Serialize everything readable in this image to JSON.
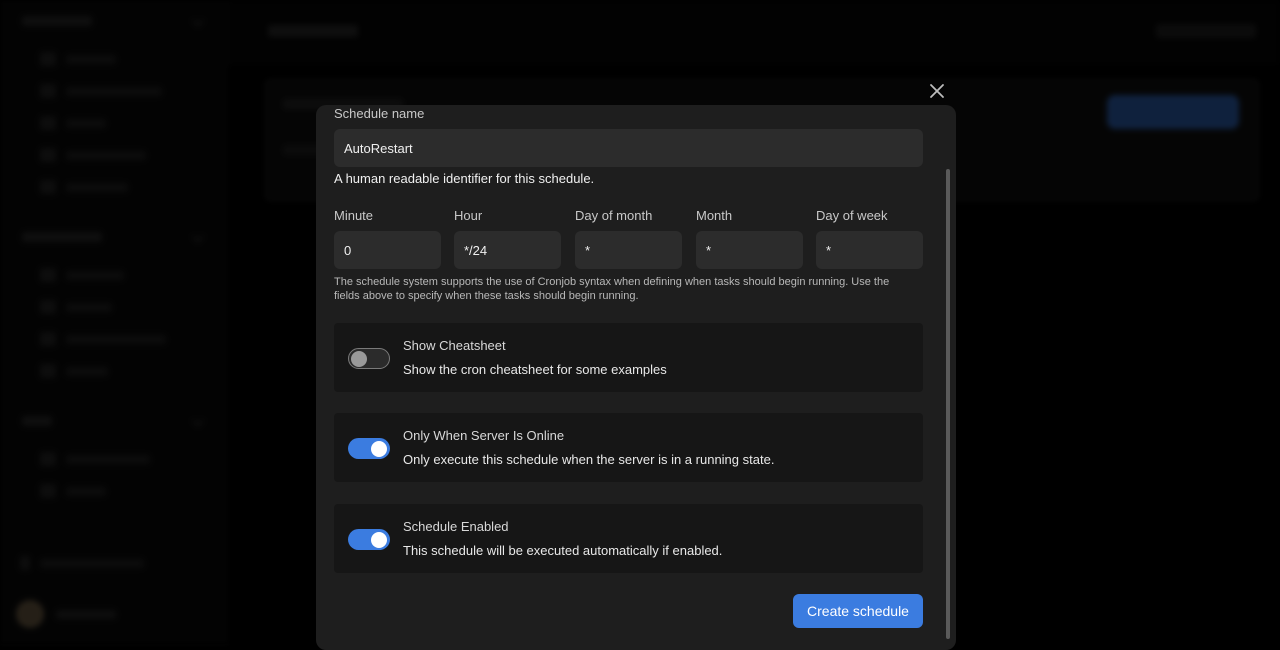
{
  "modal": {
    "schedule_name": {
      "label": "Schedule name",
      "value": "AutoRestart",
      "helper": "A human readable identifier for this schedule."
    },
    "cron_fields": [
      {
        "label": "Minute",
        "value": "0"
      },
      {
        "label": "Hour",
        "value": "*/24"
      },
      {
        "label": "Day of month",
        "value": "*"
      },
      {
        "label": "Month",
        "value": "*"
      },
      {
        "label": "Day of week",
        "value": "*"
      }
    ],
    "cron_note": "The schedule system supports the use of Cronjob syntax when defining when tasks should begin running. Use the fields above to specify when these tasks should begin running.",
    "options": [
      {
        "title": "Show Cheatsheet",
        "description": "Show the cron cheatsheet for some examples",
        "enabled": false
      },
      {
        "title": "Only When Server Is Online",
        "description": "Only execute this schedule when the server is in a running state.",
        "enabled": true
      },
      {
        "title": "Schedule Enabled",
        "description": "This schedule will be executed automatically if enabled.",
        "enabled": true
      }
    ],
    "submit_label": "Create schedule",
    "close_icon": "close-icon"
  },
  "colors": {
    "accent": "#3b7ce0",
    "modal_bg": "#1e1e1e",
    "input_bg": "#2c2c2c",
    "option_bg": "#161616"
  }
}
